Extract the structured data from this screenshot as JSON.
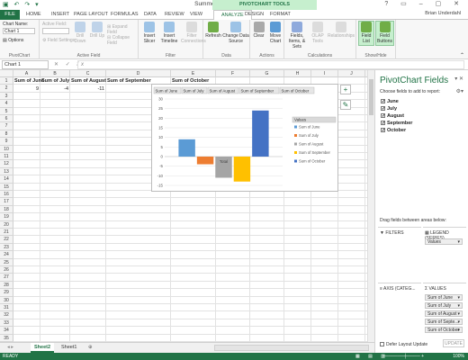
{
  "window": {
    "title": "Summer Sales Results - Excel",
    "user": "Brian Underdahl",
    "pivot_tools": "PIVOTCHART TOOLS"
  },
  "tabs": [
    "HOME",
    "INSERT",
    "PAGE LAYOUT",
    "FORMULAS",
    "DATA",
    "REVIEW",
    "VIEW",
    "ANALYZE",
    "DESIGN",
    "FORMAT"
  ],
  "file_tab": "FILE",
  "ribbon": {
    "chart_name_label": "Chart Name:",
    "chart_name_value": "Chart 1",
    "options": "Options",
    "group_pivotchart": "PivotChart",
    "active_field_label": "Active Field:",
    "field_settings": "Field Settings",
    "drill_down": "Drill Down",
    "drill_up": "Drill Up",
    "expand_field": "Expand Field",
    "collapse_field": "Collapse Field",
    "group_active_field": "Active Field",
    "insert_slicer": "Insert Slicer",
    "insert_timeline": "Insert Timeline",
    "filter_connections": "Filter Connections",
    "group_filter": "Filter",
    "refresh": "Refresh",
    "change_data_source": "Change Data Source",
    "group_data": "Data",
    "clear": "Clear",
    "move_chart": "Move Chart",
    "group_actions": "Actions",
    "fields_items_sets": "Fields, Items, & Sets",
    "olap_tools": "OLAP Tools",
    "relationships": "Relationships",
    "group_calculations": "Calculations",
    "field_list": "Field List",
    "field_buttons": "Field Buttons",
    "group_show_hide": "Show/Hide"
  },
  "name_box": "Chart 1",
  "columns": [
    "A",
    "B",
    "C",
    "D",
    "E",
    "F",
    "G",
    "H",
    "I",
    "J",
    "K"
  ],
  "rows": [
    "1",
    "2",
    "3",
    "4",
    "5",
    "6",
    "7",
    "8",
    "9",
    "10",
    "11",
    "12",
    "13",
    "14",
    "15",
    "16",
    "17",
    "18",
    "19",
    "20",
    "21",
    "22",
    "23",
    "24",
    "25",
    "26",
    "27",
    "28",
    "29",
    "30",
    "31",
    "32",
    "33",
    "34",
    "35"
  ],
  "table": {
    "headers": [
      "Sum of June",
      "Sum of July",
      "Sum of August",
      "Sum of September",
      "Sum of October"
    ],
    "values": [
      "9",
      "-4",
      "-11",
      "-13",
      ""
    ]
  },
  "chart_data": {
    "type": "bar",
    "categories": [
      "Total"
    ],
    "series": [
      {
        "name": "Sum of June",
        "values": [
          9
        ],
        "color": "#5b9bd5"
      },
      {
        "name": "Sum of July",
        "values": [
          -4
        ],
        "color": "#ed7d31"
      },
      {
        "name": "Sum of August",
        "values": [
          -11
        ],
        "color": "#a5a5a5"
      },
      {
        "name": "Sum of September",
        "values": [
          -13
        ],
        "color": "#ffc000"
      },
      {
        "name": "Sum of October",
        "values": [
          24
        ],
        "color": "#4472c4"
      }
    ],
    "field_buttons": [
      "Sum of June",
      "Sum of July",
      "Sum of August",
      "Sum of September",
      "Sum of October"
    ],
    "legend_title": "Values",
    "ylim": [
      -15,
      30
    ],
    "yticks": [
      "30",
      "25",
      "20",
      "15",
      "10",
      "5",
      "0",
      "-5",
      "-10",
      "-15"
    ],
    "legend_position": "right",
    "grid": true
  },
  "sheets": [
    "Sheet2",
    "Sheet1"
  ],
  "status": "READY",
  "zoom": "100%",
  "panel": {
    "title": "PivotChart Fields",
    "subtitle": "Choose fields to add to report:",
    "fields": [
      {
        "label": "June",
        "checked": true
      },
      {
        "label": "July",
        "checked": true
      },
      {
        "label": "August",
        "checked": true
      },
      {
        "label": "September",
        "checked": true
      },
      {
        "label": "October",
        "checked": true
      }
    ],
    "drag_label": "Drag fields between areas below:",
    "filters": "FILTERS",
    "legend": "LEGEND (SERIES)",
    "axis": "AXIS (CATEG...",
    "values": "VALUES",
    "legend_items": [
      "Values"
    ],
    "value_items": [
      "Sum of June",
      "Sum of July",
      "Sum of August",
      "Sum of Septe...",
      "Sum of October"
    ],
    "defer": "Defer Layout Update",
    "update": "UPDATE"
  }
}
